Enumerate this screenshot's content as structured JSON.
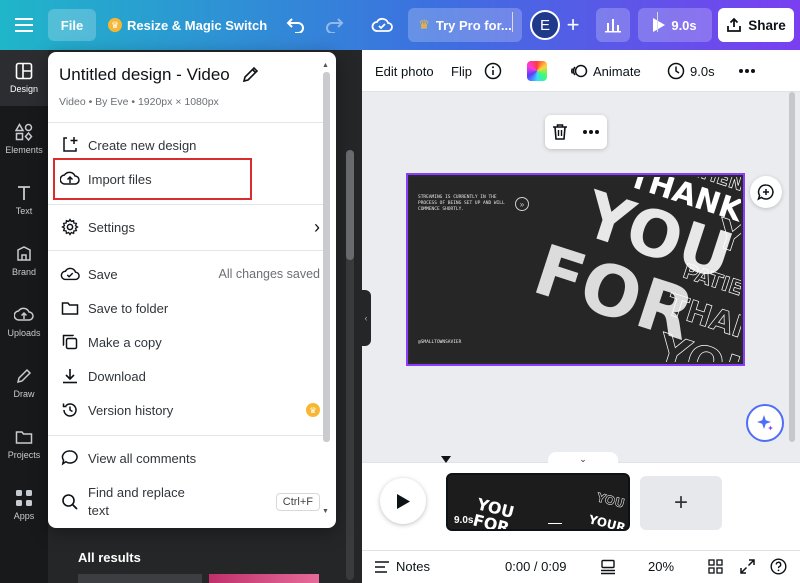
{
  "topbar": {
    "file_label": "File",
    "resize_label": "Resize & Magic Switch",
    "trypro_label": "Try Pro for...",
    "avatar_initial": "E",
    "add_label": "+",
    "play_duration": "9.0s",
    "share_label": "Share",
    "gradient_start": "#1fb6c9",
    "gradient_end": "#7a3ff0"
  },
  "rail": {
    "items": [
      {
        "label": "Design",
        "icon": "layout-icon"
      },
      {
        "label": "Elements",
        "icon": "shapes-icon"
      },
      {
        "label": "Text",
        "icon": "text-icon"
      },
      {
        "label": "Brand",
        "icon": "brand-icon"
      },
      {
        "label": "Uploads",
        "icon": "upload-cloud-icon"
      },
      {
        "label": "Draw",
        "icon": "pen-icon"
      },
      {
        "label": "Projects",
        "icon": "folder-icon"
      },
      {
        "label": "Apps",
        "icon": "apps-grid-icon"
      }
    ]
  },
  "panel": {
    "all_results": "All results"
  },
  "menu": {
    "title": "Untitled design - Video",
    "subtitle": "Video • By Eve • 1920px × 1080px",
    "create_new": "Create new design",
    "import_files": "Import files",
    "settings": "Settings",
    "save": "Save",
    "save_status": "All changes saved",
    "save_to_folder": "Save to folder",
    "make_copy": "Make a copy",
    "download": "Download",
    "version_history": "Version history",
    "view_comments": "View all comments",
    "find_replace": "Find and replace text",
    "find_replace_shortcut": "Ctrl+F"
  },
  "context_toolbar": {
    "edit_photo": "Edit photo",
    "flip": "Flip",
    "animate": "Animate",
    "duration": "9.0s"
  },
  "design": {
    "small_text": "STREAMING IS CURRENTLY IN THE PROCESS OF BEING SET UP AND WILL COMMENCE SHORTLY.",
    "handle": "@SMALLTOWNSAVIER",
    "big_words": [
      "THANK",
      "YOU",
      "FOR",
      "YOUR",
      "PATIENCE"
    ]
  },
  "timeline": {
    "clip_duration": "9.0s",
    "add_label": "+"
  },
  "status_bar": {
    "notes": "Notes",
    "time": "0:00 / 0:09",
    "zoom": "20%"
  }
}
